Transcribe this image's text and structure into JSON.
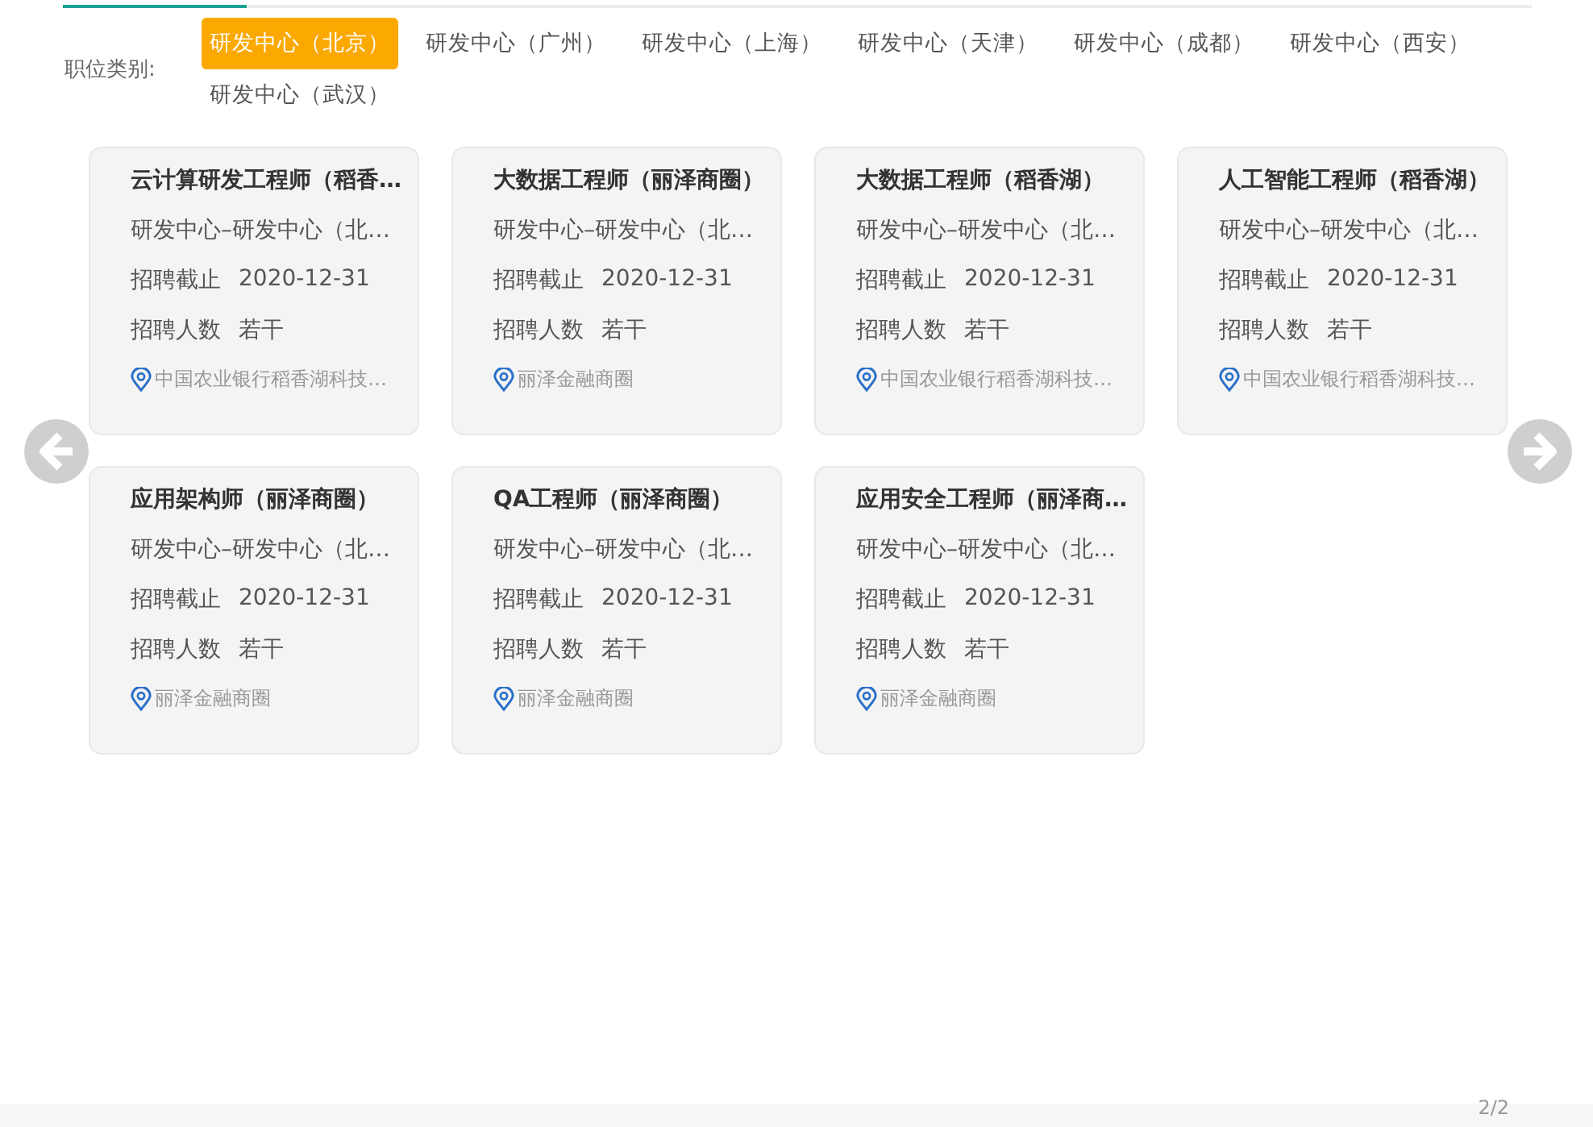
{
  "filter": {
    "label": "职位类别:",
    "options": [
      {
        "label": "研发中心（北京）",
        "selected": true
      },
      {
        "label": "研发中心（广州）",
        "selected": false
      },
      {
        "label": "研发中心（上海）",
        "selected": false
      },
      {
        "label": "研发中心（天津）",
        "selected": false
      },
      {
        "label": "研发中心（成都）",
        "selected": false
      },
      {
        "label": "研发中心（西安）",
        "selected": false
      },
      {
        "label": "研发中心（武汉）",
        "selected": false
      }
    ]
  },
  "jobs": [
    {
      "title": "云计算研发工程师（稻香…",
      "department": "研发中心–研发中心（北…",
      "deadline_label": "招聘截止",
      "deadline": "2020-12-31",
      "count_label": "招聘人数",
      "count": "若干",
      "location": "中国农业银行稻香湖科技…"
    },
    {
      "title": "大数据工程师（丽泽商圈）",
      "department": "研发中心–研发中心（北…",
      "deadline_label": "招聘截止",
      "deadline": "2020-12-31",
      "count_label": "招聘人数",
      "count": "若干",
      "location": "丽泽金融商圈"
    },
    {
      "title": "大数据工程师（稻香湖）",
      "department": "研发中心–研发中心（北…",
      "deadline_label": "招聘截止",
      "deadline": "2020-12-31",
      "count_label": "招聘人数",
      "count": "若干",
      "location": "中国农业银行稻香湖科技…"
    },
    {
      "title": "人工智能工程师（稻香湖）",
      "department": "研发中心–研发中心（北…",
      "deadline_label": "招聘截止",
      "deadline": "2020-12-31",
      "count_label": "招聘人数",
      "count": "若干",
      "location": "中国农业银行稻香湖科技…"
    },
    {
      "title": "应用架构师（丽泽商圈）",
      "department": "研发中心–研发中心（北…",
      "deadline_label": "招聘截止",
      "deadline": "2020-12-31",
      "count_label": "招聘人数",
      "count": "若干",
      "location": "丽泽金融商圈"
    },
    {
      "title": "QA工程师（丽泽商圈）",
      "department": "研发中心–研发中心（北…",
      "deadline_label": "招聘截止",
      "deadline": "2020-12-31",
      "count_label": "招聘人数",
      "count": "若干",
      "location": "丽泽金融商圈"
    },
    {
      "title": "应用安全工程师（丽泽商…",
      "department": "研发中心–研发中心（北…",
      "deadline_label": "招聘截止",
      "deadline": "2020-12-31",
      "count_label": "招聘人数",
      "count": "若干",
      "location": "丽泽金融商圈"
    }
  ],
  "pager": "2/2"
}
